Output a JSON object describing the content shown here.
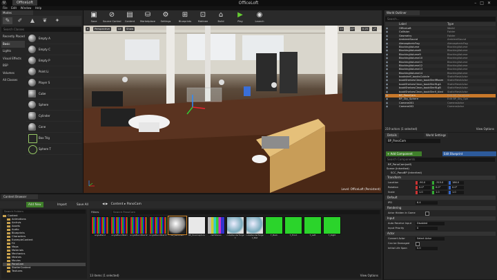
{
  "window": {
    "tab": "OfficeLoft",
    "title": "OfficeLoft",
    "menu": [
      "File",
      "Edit",
      "Window",
      "Help"
    ]
  },
  "modes": {
    "tab": "Modes",
    "search_placeholder": "Search Classes",
    "categories": [
      "Recently Placed",
      "Basic",
      "Lights",
      "Visual Effects",
      "BSP",
      "Volumes",
      "All Classes"
    ],
    "active_category": 1,
    "items": [
      "Empty A",
      "Empty C",
      "Empty P",
      "Point Li",
      "Player S",
      "Cube",
      "Sphere",
      "Cylinder",
      "Cone",
      "Box Trig",
      "Sphere T"
    ]
  },
  "toolbar": {
    "buttons": [
      {
        "label": "Save",
        "icon": "save-icon",
        "glyph": "▣"
      },
      {
        "label": "Source Control",
        "icon": "source-control-icon",
        "glyph": "⊘"
      },
      {
        "label": "Content",
        "icon": "content-icon",
        "glyph": "▤"
      },
      {
        "label": "Marketplace",
        "icon": "marketplace-icon",
        "glyph": "⛁"
      },
      {
        "label": "Settings",
        "icon": "settings-icon",
        "glyph": "⚙"
      },
      {
        "label": "Blueprints",
        "icon": "blueprints-icon",
        "glyph": "⊞"
      },
      {
        "label": "Matinee",
        "icon": "matinee-icon",
        "glyph": "⊡"
      },
      {
        "label": "Build",
        "icon": "build-icon",
        "glyph": "⌂"
      },
      {
        "label": "Play",
        "icon": "play-icon",
        "glyph": "▶"
      },
      {
        "label": "Launch",
        "icon": "launch-icon",
        "glyph": "◉"
      }
    ]
  },
  "viewport": {
    "buttons": [
      "Perspective",
      "Lit",
      "Show"
    ],
    "snaps": [
      "10",
      "10°",
      "0.25"
    ],
    "level_label": "Level: OfficeLoft (Persistent)"
  },
  "outliner": {
    "tab": "World Outliner",
    "search_placeholder": "Search...",
    "col_label": "Label",
    "col_type": "Type",
    "rows": [
      {
        "name": "OfficeLoft",
        "type": "World"
      },
      {
        "name": "Collision",
        "type": "Folder"
      },
      {
        "name": "Geometry",
        "type": "Folder"
      },
      {
        "name": "AmbientSound",
        "type": "AmbientSound"
      },
      {
        "name": "AtmosphericFog",
        "type": "AtmosphericFog"
      },
      {
        "name": "BlockingVolume",
        "type": "BlockingVolume"
      },
      {
        "name": "BlockingVolume8",
        "type": "BlockingVolume"
      },
      {
        "name": "BlockingVolume9",
        "type": "BlockingVolume"
      },
      {
        "name": "BlockingVolume10",
        "type": "BlockingVolume"
      },
      {
        "name": "BlockingVolume11",
        "type": "BlockingVolume"
      },
      {
        "name": "BlockingVolume12",
        "type": "BlockingVolume"
      },
      {
        "name": "BlockingVolume13",
        "type": "BlockingVolume"
      },
      {
        "name": "BlockingVolume14",
        "type": "BlockingVolume"
      },
      {
        "name": "bookshelf_booksCubicle",
        "type": "StaticMeshActor"
      },
      {
        "name": "bookShelvesClean_bookShelfRoom",
        "type": "StaticMeshActor"
      },
      {
        "name": "bookShelvesClean_bookShelfLgA",
        "type": "StaticMeshActor"
      },
      {
        "name": "bookShelvesClean_bookShelfLgB",
        "type": "StaticMeshActor"
      },
      {
        "name": "bookShelvesClean_bookShelf_tiled",
        "type": "StaticMeshActor"
      },
      {
        "name": "BP_PanoCam",
        "type": "Edit BP_PanoCam"
      },
      {
        "name": "BP_Sky_Sphere",
        "type": "Edit BP_Sky_Sph"
      },
      {
        "name": "Camera001",
        "type": "CameraActor"
      },
      {
        "name": "Camera002",
        "type": "CameraActor"
      }
    ],
    "selected_row": 18,
    "status": "219 actors (1 selected)",
    "view_options": "View Options"
  },
  "details": {
    "tabs": [
      "Details",
      "World Settings"
    ],
    "actor_name": "BP_PanoCam",
    "add_component": "+ Add Component",
    "edit_blueprint": "Edit Blueprint",
    "search_placeholder": "Search Components",
    "tree": [
      "BP_PanoCam(self)",
      "Scene (Inherited)",
      "SCC_PanoBP (Inherited)"
    ],
    "sections": {
      "transform": "Transform",
      "default": "Default",
      "rendering": "Rendering",
      "input": "Input",
      "actor": "Actor"
    },
    "location_label": "Location",
    "location": [
      "-90.0",
      "-315.0",
      "186.0"
    ],
    "rotation_label": "Rotation",
    "rotation": [
      "0.0°",
      "0.0°",
      "0.0°"
    ],
    "scale_label": "Scale",
    "scale": [
      "1.0",
      "1.0",
      "1.0"
    ],
    "ipd_label": "IPD",
    "ipd": "6.4",
    "hidden_label": "Actor Hidden In Game",
    "auto_receive_label": "Auto Receive Input",
    "auto_receive": "Disabled",
    "input_priority_label": "Input Priority",
    "input_priority": "0",
    "convert_actor_label": "Convert Actor",
    "convert_actor": "Select Actor",
    "can_damaged_label": "Can be Damaged",
    "life_span_label": "Initial Life Span",
    "life_span": "0.0"
  },
  "content_browser": {
    "tab": "Content Browser",
    "add_new": "Add New",
    "import": "Import",
    "save_all": "Save All",
    "path": [
      "Content",
      "PanoCam"
    ],
    "search_folders_placeholder": "Search Folders",
    "filters": "Filters",
    "search_assets_placeholder": "Search PanoCam",
    "folders": [
      "Content",
      "Animations",
      "Archvis",
      "Assets",
      "Audio",
      "Blueprints",
      "Characters",
      "ExampleContent",
      "FX",
      "Maps",
      "Materials",
      "Mechanics",
      "Meshes",
      "Movies",
      "PanoCam",
      "StarterContent",
      "Textures"
    ],
    "selected_folder": 14,
    "assets": [
      {
        "label": "angleBlend",
        "kind": "bars"
      },
      {
        "label": "angleBlendStart",
        "kind": "bars"
      },
      {
        "label": "angleBlendStart2",
        "kind": "bars"
      },
      {
        "label": "angleBlendStart3",
        "kind": "bars"
      },
      {
        "label": "BP_PanoCam",
        "kind": "sphere"
      },
      {
        "label": "BP_PanoCapture",
        "kind": "blank"
      },
      {
        "label": "camStereo",
        "kind": "tv"
      },
      {
        "label": "cubeRenderTarget",
        "kind": "sphere-blue"
      },
      {
        "label": "cubeRenderTarget_Mat",
        "kind": "sphere-blue"
      },
      {
        "label": "T_Back",
        "kind": "green"
      },
      {
        "label": "T_Front",
        "kind": "green"
      },
      {
        "label": "T_Left",
        "kind": "green"
      },
      {
        "label": "T_Right",
        "kind": "green"
      }
    ],
    "status": "13 items (1 selected)",
    "view_options": "View Options"
  }
}
